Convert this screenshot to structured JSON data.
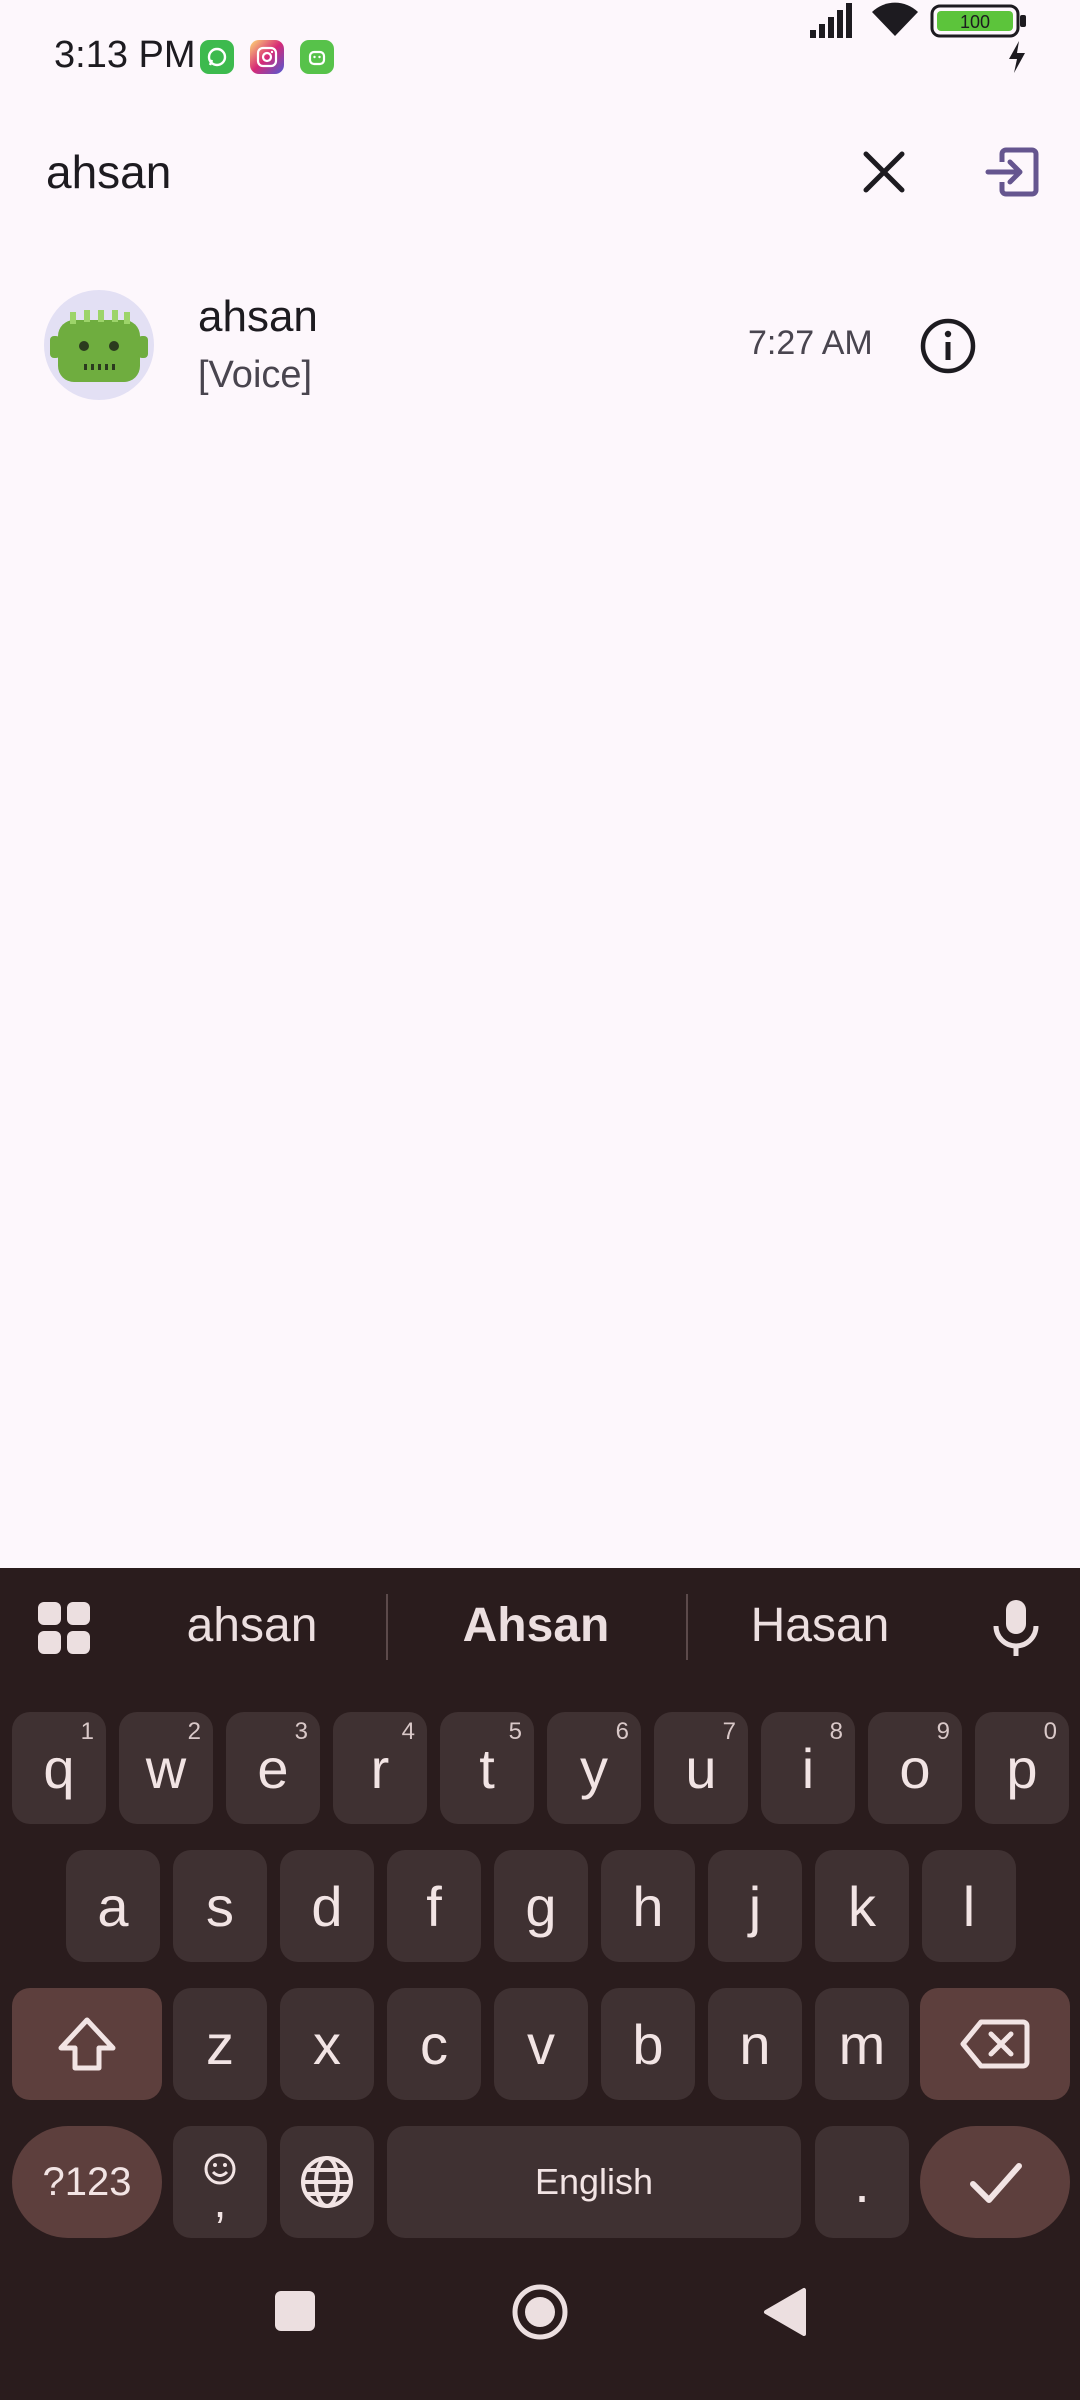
{
  "status_bar": {
    "time": "3:13 PM",
    "battery_level": "100",
    "notification_icons": [
      "whatsapp-icon",
      "instagram-icon",
      "android-icon"
    ]
  },
  "search": {
    "query": "ahsan",
    "clear_icon": "close-icon",
    "exit_icon": "exit-to-app-icon"
  },
  "results": [
    {
      "name": "ahsan",
      "preview": "[Voice]",
      "time": "7:27 AM",
      "avatar": "android-robot-avatar"
    }
  ],
  "keyboard": {
    "suggestions": [
      "ahsan",
      "Ahsan",
      "Hasan"
    ],
    "row1": [
      {
        "key": "q",
        "hint": "1"
      },
      {
        "key": "w",
        "hint": "2"
      },
      {
        "key": "e",
        "hint": "3"
      },
      {
        "key": "r",
        "hint": "4"
      },
      {
        "key": "t",
        "hint": "5"
      },
      {
        "key": "y",
        "hint": "6"
      },
      {
        "key": "u",
        "hint": "7"
      },
      {
        "key": "i",
        "hint": "8"
      },
      {
        "key": "o",
        "hint": "9"
      },
      {
        "key": "p",
        "hint": "0"
      }
    ],
    "row2": [
      "a",
      "s",
      "d",
      "f",
      "g",
      "h",
      "j",
      "k",
      "l"
    ],
    "row3": [
      "z",
      "x",
      "c",
      "v",
      "b",
      "n",
      "m"
    ],
    "symbols_label": "?123",
    "comma_label": ",",
    "space_label": "English",
    "period_label": "."
  },
  "colors": {
    "background": "#fdf7fc",
    "keyboard_bg": "#2a1c1d",
    "key_bg": "#3f3132",
    "special_key_bg": "#5d3f3d",
    "accent": "#65558f"
  }
}
